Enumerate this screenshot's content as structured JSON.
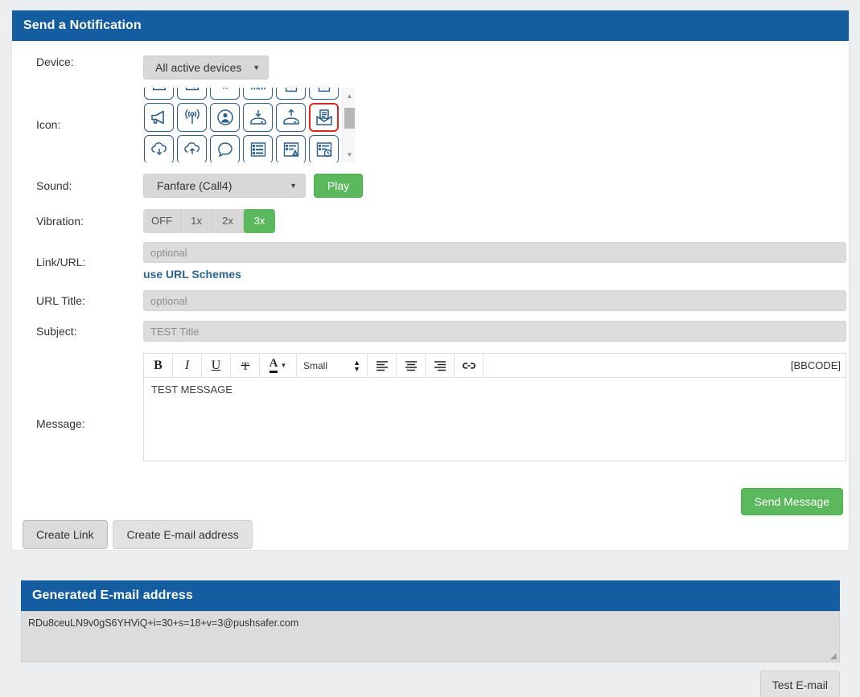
{
  "main_panel": {
    "title": "Send a Notification",
    "fields": {
      "device_label": "Device:",
      "device_value": "All active devices",
      "icon_label": "Icon:",
      "sound_label": "Sound:",
      "sound_value": "Fanfare (Call4)",
      "play_label": "Play",
      "vibration_label": "Vibration:",
      "link_label": "Link/URL:",
      "link_placeholder": "optional",
      "link_value": "",
      "url_schemes_link": "use URL Schemes",
      "url_title_label": "URL Title:",
      "url_title_placeholder": "optional",
      "url_title_value": "",
      "subject_label": "Subject:",
      "subject_placeholder": "TEST Title",
      "subject_value": "",
      "message_label": "Message:",
      "message_value": "TEST MESSAGE"
    },
    "vibration_options": [
      {
        "label": "OFF",
        "active": false
      },
      {
        "label": "1x",
        "active": false
      },
      {
        "label": "2x",
        "active": false
      },
      {
        "label": "3x",
        "active": true
      }
    ],
    "editor_toolbar": {
      "bold": "B",
      "italic": "I",
      "underline": "U",
      "strike": "T",
      "color": "A",
      "font_size": "Small",
      "bbcode": "[BBCODE]"
    },
    "buttons": {
      "send_message": "Send Message",
      "create_link": "Create Link",
      "create_email": "Create E-mail address"
    },
    "icon_picker": {
      "selected_index": 11,
      "icons": [
        "book-down-icon",
        "tray-in-icon",
        "funnel-icon",
        "radar-icon",
        "box-up-icon",
        "box-up-2-icon",
        "megaphone-icon",
        "antenna-signal-icon",
        "user-circle-icon",
        "drive-download-icon",
        "drive-upload-icon",
        "mail-document-icon",
        "cloud-download-icon",
        "cloud-upload-icon",
        "speech-bubble-icon",
        "server-list-icon",
        "server-warning-icon",
        "server-clock-icon"
      ]
    }
  },
  "email_panel": {
    "title": "Generated E-mail address",
    "address": "RDu8ceuLN9v0gS6YHViQ+i=30+s=18+v=3@pushsafer.com",
    "test_button": "Test E-mail"
  },
  "colors": {
    "header_blue": "#145da0",
    "green": "#5cb85c",
    "selected_red": "#d9291c",
    "link_blue": "#2a6496",
    "icon_stroke": "#2c5f8a"
  }
}
